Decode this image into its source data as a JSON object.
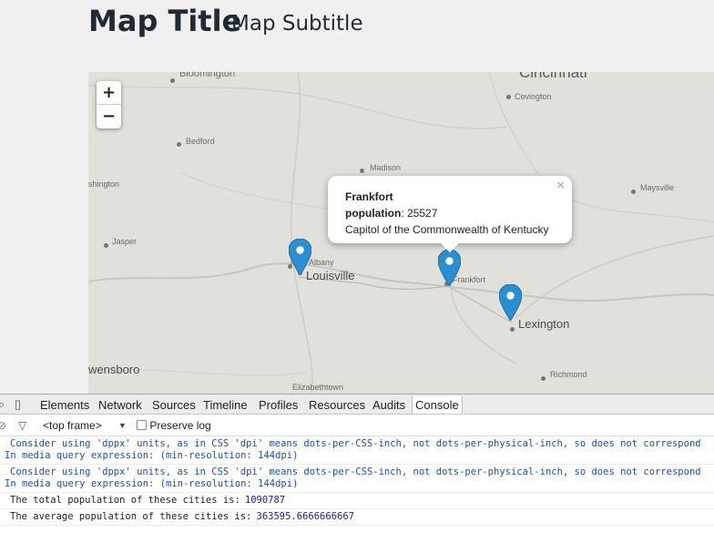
{
  "header": {
    "title": "Map Title",
    "subtitle": "Map Subtitle"
  },
  "map": {
    "zoom_in": "+",
    "zoom_out": "−",
    "cities": {
      "bloomington": "Bloomington",
      "cincinnati": "Cincinnati",
      "covington": "Covington",
      "bedford": "Bedford",
      "madison": "Madison",
      "washington": "shington",
      "maysville": "Maysville",
      "jasper": "Jasper",
      "new_albany": "New Albany",
      "louisville": "Louisville",
      "frankfort": "Frankfort",
      "lexington": "Lexington",
      "owensboro": "wensboro",
      "richmond": "Richmond",
      "elizabethtown": "Elizabethtown"
    },
    "marker_color": "#2a8fd0",
    "popup": {
      "city": "Frankfort",
      "population_label": "population",
      "population_value": ": 25527",
      "description": "Capitol of the Commonwealth of Kentucky",
      "close": "×"
    }
  },
  "devtools": {
    "tabs": [
      "Elements",
      "Network",
      "Sources",
      "Timeline",
      "Profiles",
      "Resources",
      "Audits",
      "Console"
    ],
    "active_tab": "Console",
    "frame_select": "<top frame>",
    "preserve_log": "Preserve log",
    "messages": [
      {
        "line1": "Consider using 'dppx' units, as in CSS 'dpi' means dots-per-CSS-inch, not dots-per-physical-inch, so does not correspond",
        "line2": "In media query expression: (min-resolution: 144dpi)"
      },
      {
        "line1": "Consider using 'dppx' units, as in CSS 'dpi' means dots-per-CSS-inch, not dots-per-physical-inch, so does not correspond",
        "line2": "In media query expression: (min-resolution: 144dpi)"
      }
    ],
    "logs": [
      {
        "text": "The total population of these cities is:",
        "value": "1090787"
      },
      {
        "text": "The average population of these cities is:",
        "value": "363595.6666666667"
      }
    ]
  }
}
